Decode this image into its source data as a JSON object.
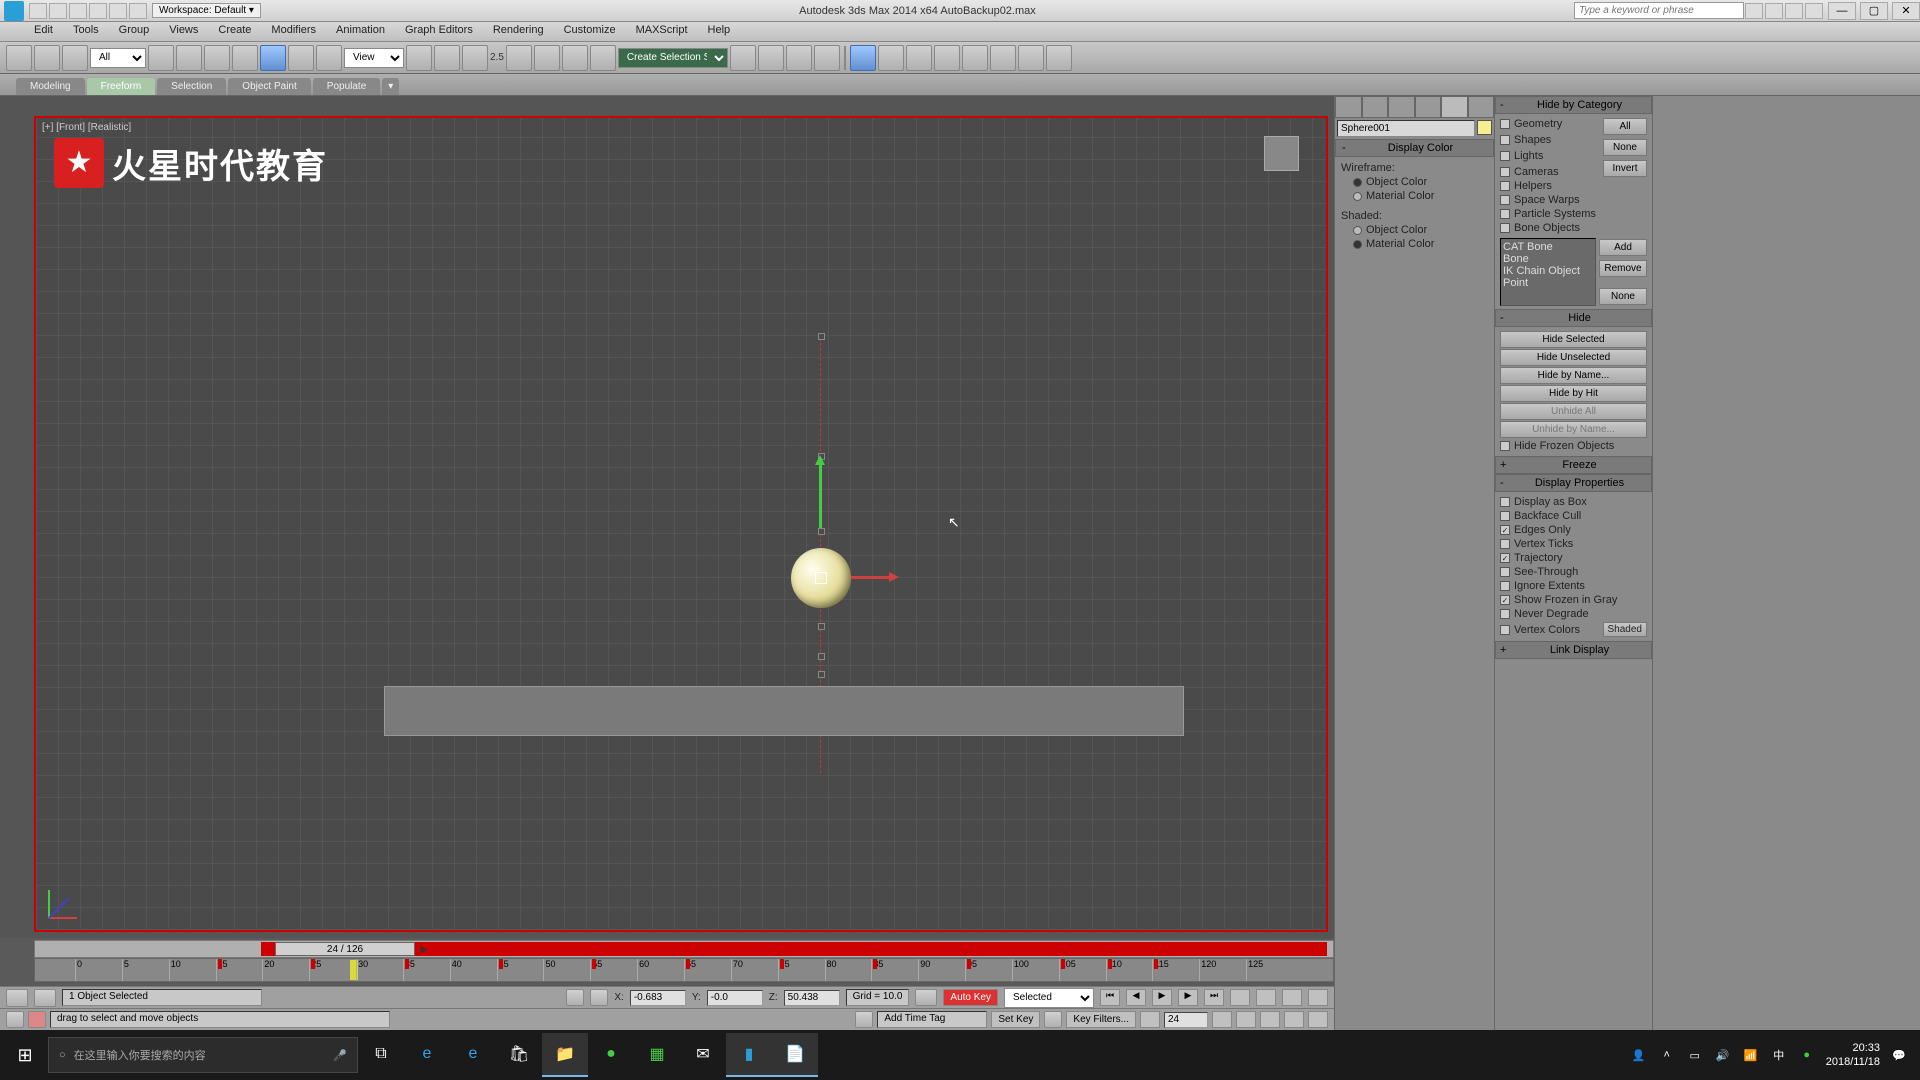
{
  "title_bar": {
    "workspace": "Workspace: Default ▾",
    "app_title": "Autodesk 3ds Max  2014 x64      AutoBackup02.max",
    "search_placeholder": "Type a keyword or phrase"
  },
  "menu": [
    "Edit",
    "Tools",
    "Group",
    "Views",
    "Create",
    "Modifiers",
    "Animation",
    "Graph Editors",
    "Rendering",
    "Customize",
    "MAXScript",
    "Help"
  ],
  "toolbar": {
    "filter_all": "All",
    "view_dd": "View",
    "coord_25": "2.5",
    "sel_set": "Create Selection Se..."
  },
  "ribbon": {
    "tabs": [
      "Modeling",
      "Freeform",
      "Selection",
      "Object Paint",
      "Populate"
    ]
  },
  "viewport": {
    "label": "[+] [Front] [Realistic]",
    "logo_text": "火星时代教育"
  },
  "timeline": {
    "thumb": "24 / 126",
    "ticks": [
      "0",
      "5",
      "10",
      "15",
      "20",
      "25",
      "30",
      "35",
      "40",
      "45",
      "50",
      "55",
      "60",
      "65",
      "70",
      "75",
      "80",
      "85",
      "90",
      "95",
      "100",
      "105",
      "110",
      "115",
      "120",
      "125"
    ]
  },
  "status": {
    "sel_info": "1 Object Selected",
    "prompt": "drag to select and move objects",
    "x_label": "X:",
    "x_val": "-0.683",
    "y_label": "Y:",
    "y_val": "-0.0",
    "z_label": "Z:",
    "z_val": "50.438",
    "grid": "Grid = 10.0",
    "auto_key": "Auto Key",
    "set_key": "Set Key",
    "key_mode": "Selected",
    "key_filters": "Key Filters...",
    "frame_field": "24",
    "add_time_tag": "Add Time Tag"
  },
  "cmd_panel": {
    "obj_name": "Sphere001",
    "rollout_display_color": "Display Color",
    "wf_label": "Wireframe:",
    "sh_label": "Shaded:",
    "opt_obj_color": "Object Color",
    "opt_mat_color": "Material Color"
  },
  "disp_panel": {
    "hide_cat": "Hide by Category",
    "cats": {
      "geometry": "Geometry",
      "shapes": "Shapes",
      "lights": "Lights",
      "cameras": "Cameras",
      "helpers": "Helpers",
      "space_warps": "Space Warps",
      "particle": "Particle Systems",
      "bone": "Bone Objects"
    },
    "btn_all": "All",
    "btn_none": "None",
    "btn_invert": "Invert",
    "list_items": [
      "CAT Bone",
      "Bone",
      "IK Chain Object",
      "Point"
    ],
    "btn_add": "Add",
    "btn_remove": "Remove",
    "btn_none2": "None",
    "hide": "Hide",
    "hide_sel": "Hide Selected",
    "hide_unsel": "Hide Unselected",
    "hide_name": "Hide by Name...",
    "hide_hit": "Hide by Hit",
    "unhide_all": "Unhide All",
    "unhide_name": "Unhide by Name...",
    "hide_frozen": "Hide Frozen Objects",
    "freeze": "Freeze",
    "disp_props": "Display Properties",
    "props": {
      "as_box": "Display as Box",
      "backface": "Backface Cull",
      "edges": "Edges Only",
      "vticks": "Vertex Ticks",
      "traj": "Trajectory",
      "see_through": "See-Through",
      "ignore_ext": "Ignore Extents",
      "show_frozen": "Show Frozen in Gray",
      "never_deg": "Never Degrade",
      "vcolors": "Vertex Colors"
    },
    "shaded_btn": "Shaded",
    "link_display": "Link Display"
  },
  "taskbar": {
    "search_placeholder": "在这里输入你要搜索的内容",
    "time": "20:33",
    "date": "2018/11/18"
  }
}
